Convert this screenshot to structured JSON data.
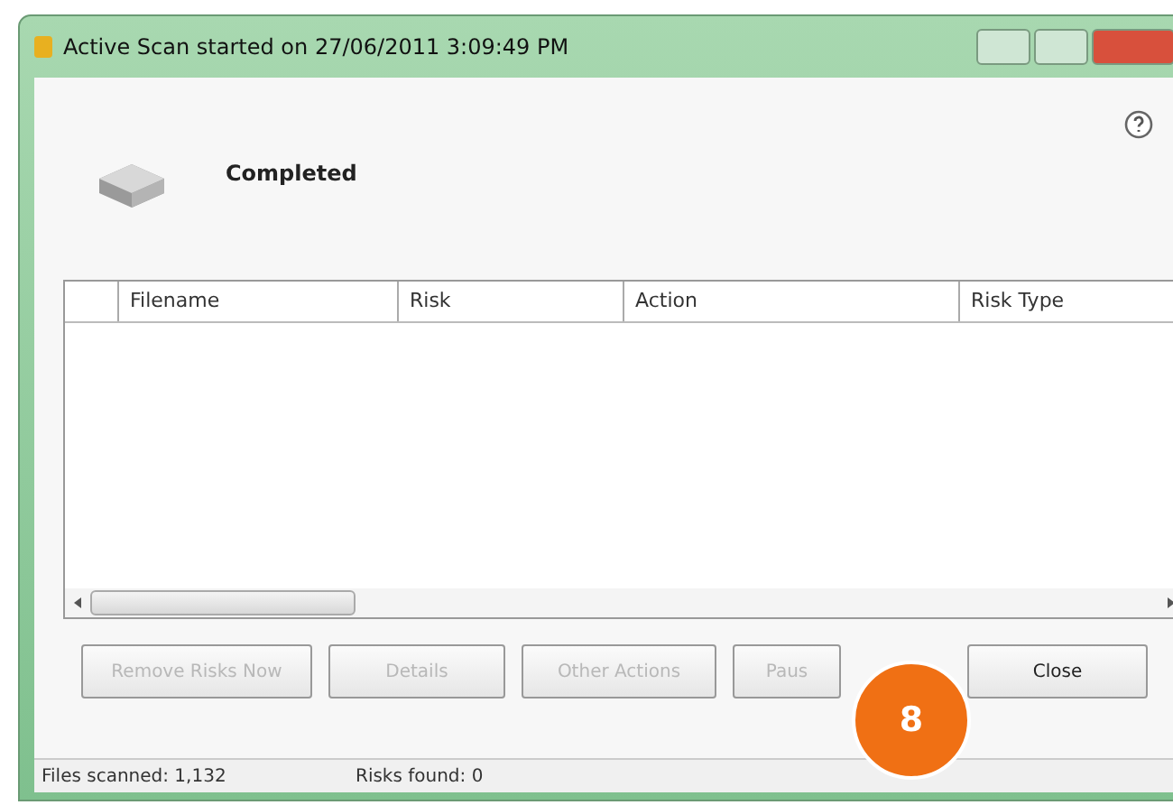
{
  "window": {
    "title": "Active Scan started on 27/06/2011 3:09:49 PM"
  },
  "status": {
    "text": "Completed"
  },
  "table": {
    "columns": [
      "Filename",
      "Risk",
      "Action",
      "Risk Type"
    ]
  },
  "buttons": [
    {
      "label": "Remove Risks Now",
      "disabled": true
    },
    {
      "label": "Details",
      "disabled": true
    },
    {
      "label": "Other Actions",
      "disabled": true
    },
    {
      "label": "Paus",
      "disabled": true
    },
    {
      "label": "Close",
      "disabled": false
    }
  ],
  "callout": "8",
  "status_bar": [
    "Files scanned: 1,132",
    "Risks found: 0"
  ]
}
